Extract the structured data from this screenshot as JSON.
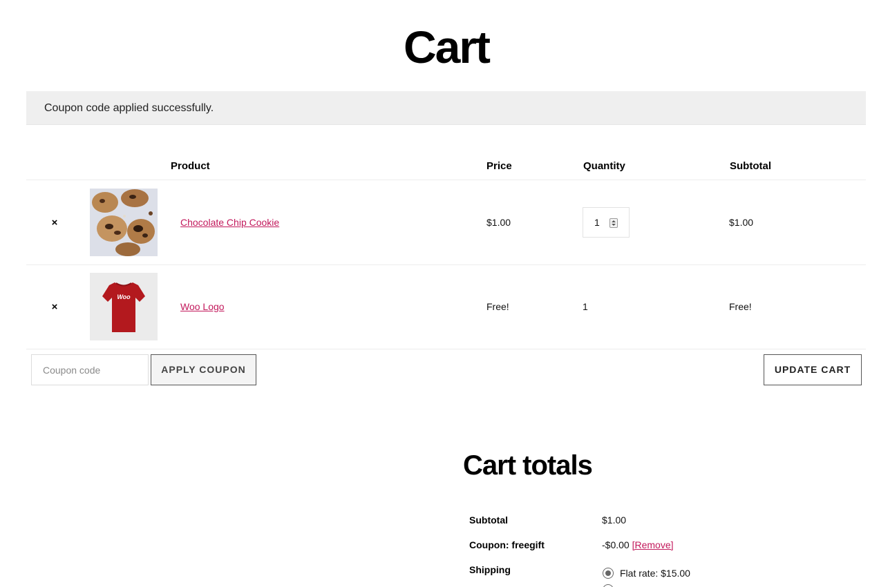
{
  "page": {
    "title": "Cart"
  },
  "notice": {
    "message": "Coupon code applied successfully."
  },
  "table": {
    "headers": {
      "product": "Product",
      "price": "Price",
      "quantity": "Quantity",
      "subtotal": "Subtotal"
    },
    "items": [
      {
        "remove": "×",
        "name": "Chocolate Chip Cookie",
        "price": "$1.00",
        "quantity": "1",
        "subtotal": "$1.00",
        "image": "cookies-photo"
      },
      {
        "remove": "×",
        "name": "Woo Logo",
        "price": "Free!",
        "quantity": "1",
        "subtotal": "Free!",
        "image": "red-tshirt-photo",
        "shirt_text": "Woo"
      }
    ]
  },
  "coupon": {
    "placeholder": "Coupon code",
    "apply_label": "APPLY COUPON"
  },
  "actions": {
    "update_label": "UPDATE CART"
  },
  "totals": {
    "title": "Cart totals",
    "subtotal_label": "Subtotal",
    "subtotal_value": "$1.00",
    "coupon_label": "Coupon: freegift",
    "coupon_value": "-$0.00",
    "coupon_remove": "[Remove]",
    "shipping_label": "Shipping",
    "shipping_option": "Flat rate: $15.00"
  },
  "colors": {
    "link": "#c2185b",
    "notice_bg": "#efefef",
    "shirt": "#b3191e"
  }
}
